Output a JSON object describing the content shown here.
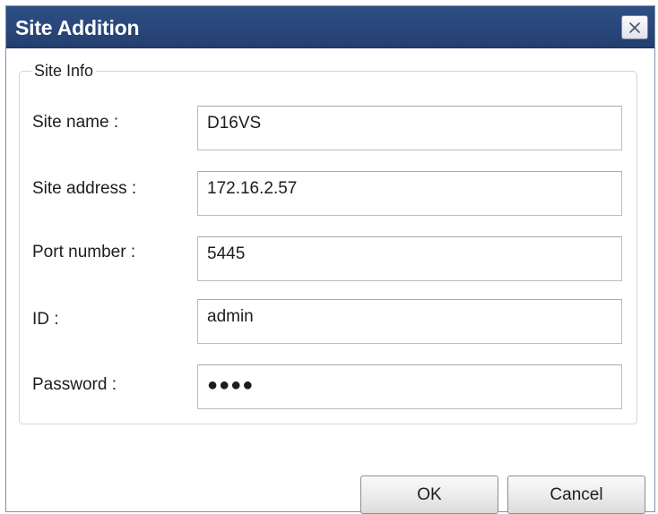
{
  "window": {
    "title": "Site Addition",
    "close_icon": "close-icon"
  },
  "site_info": {
    "legend": "Site Info",
    "fields": [
      {
        "label": "Site name :",
        "value": "D16VS"
      },
      {
        "label": "Site address :",
        "value": "172.16.2.57"
      },
      {
        "label": "Port number :",
        "value": "5445"
      },
      {
        "label": "ID :",
        "value": "admin"
      },
      {
        "label": "Password :",
        "value": "●●●●"
      }
    ]
  },
  "buttons": {
    "ok": "OK",
    "cancel": "Cancel"
  },
  "colors": {
    "titlebar": "#2d4f86",
    "title_text": "#ffffff"
  }
}
